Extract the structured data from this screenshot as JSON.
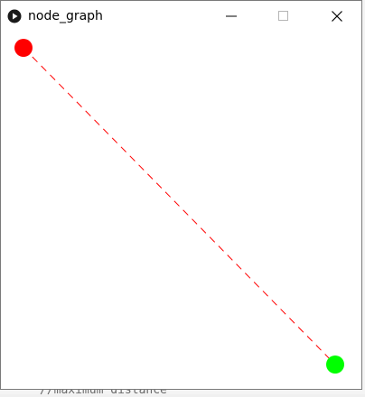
{
  "window": {
    "title": "node_graph",
    "controls": {
      "minimize": "minimize-icon",
      "maximize": "maximize-icon",
      "close": "close-icon"
    }
  },
  "graph": {
    "edge_color": "#ff0000",
    "edge_style": "dashed",
    "nodes": [
      {
        "id": "start",
        "color": "#ff0000"
      },
      {
        "id": "end",
        "color": "#00ff00"
      }
    ]
  },
  "background_editor": {
    "visible_line": "//maximum distance"
  }
}
